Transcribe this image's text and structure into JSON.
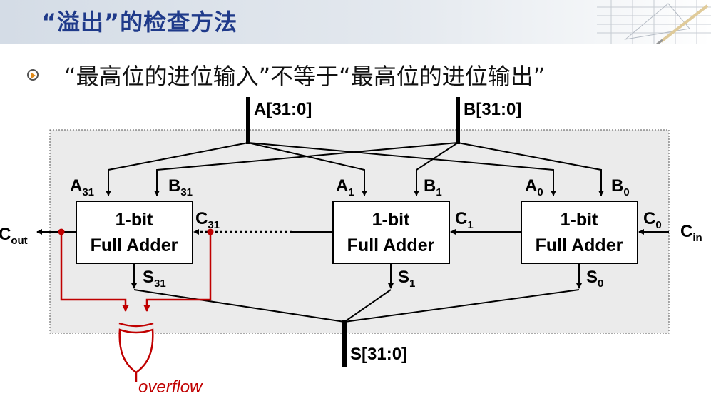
{
  "title": "“溢出”的检查方法",
  "bullet": "“最高位的进位输入”不等于“最高位的进位输出”",
  "buses": {
    "a": "A[31:0]",
    "b": "B[31:0]",
    "s": "S[31:0]"
  },
  "adders": [
    {
      "line1": "1-bit",
      "line2": "Full Adder",
      "a_label": "A",
      "b_label": "B",
      "sum_label": "S",
      "carry_in_label": "C",
      "index": "31"
    },
    {
      "line1": "1-bit",
      "line2": "Full Adder",
      "a_label": "A",
      "b_label": "B",
      "sum_label": "S",
      "carry_in_label": "C",
      "index": "1"
    },
    {
      "line1": "1-bit",
      "line2": "Full Adder",
      "a_label": "A",
      "b_label": "B",
      "sum_label": "S",
      "carry_in_label": "C",
      "index": "0"
    }
  ],
  "carry_out": {
    "main": "C",
    "sub": "out"
  },
  "carry_in": {
    "main": "C",
    "sub": "in"
  },
  "overflow_label": "overflow",
  "colors": {
    "title": "#1f3a8a",
    "overflow_logic": "#c00000",
    "bullet_arrow": "#e08a1a"
  }
}
